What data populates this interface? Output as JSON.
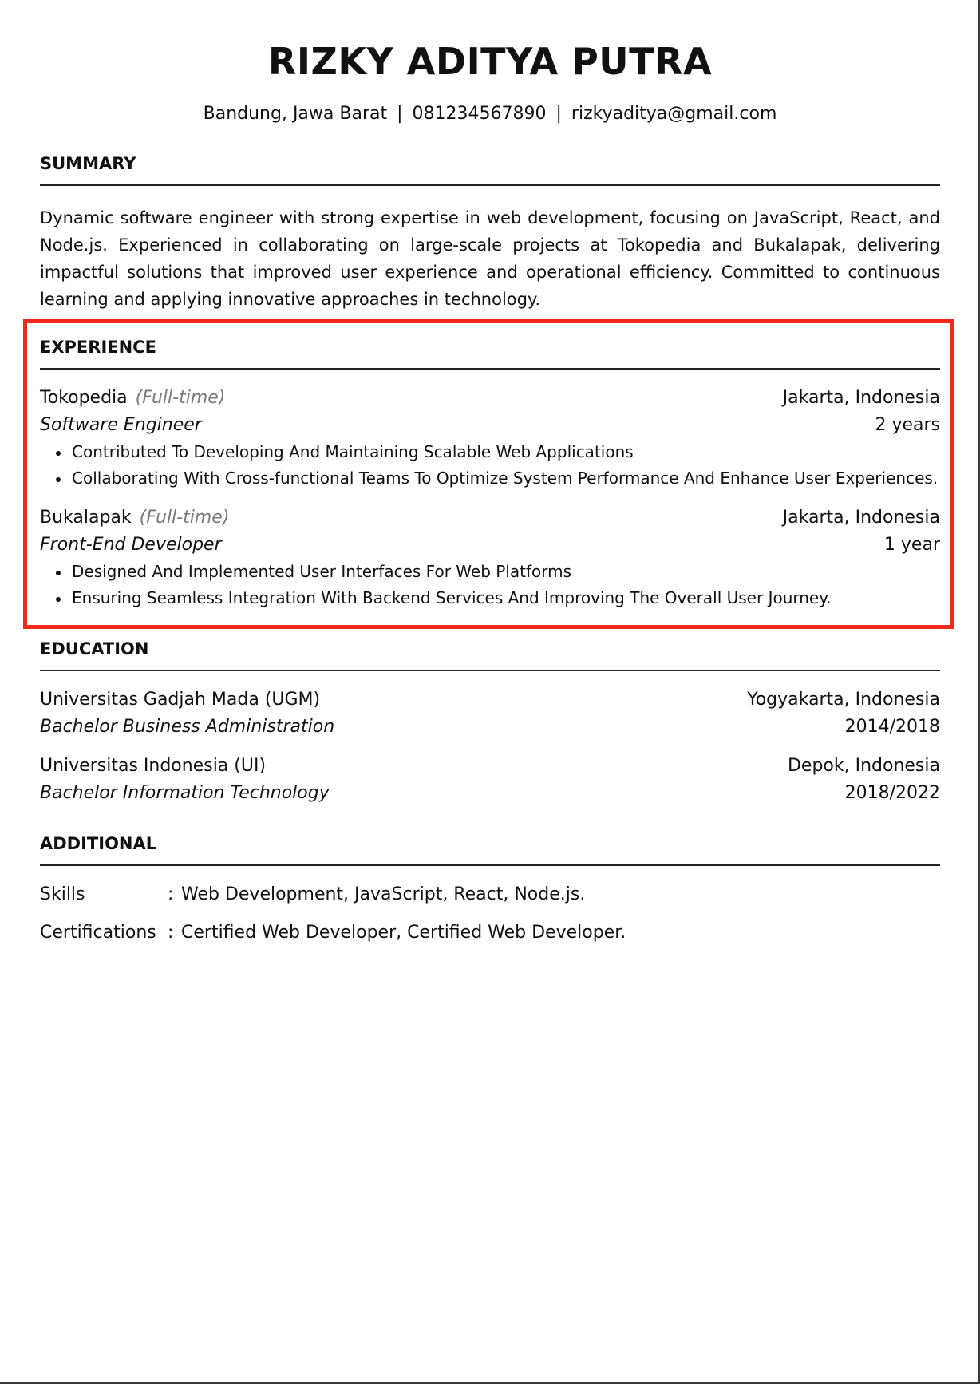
{
  "header": {
    "name": "RIZKY ADITYA PUTRA",
    "location": "Bandung, Jawa Barat",
    "phone": "081234567890",
    "email": "rizkyaditya@gmail.com",
    "separator": "|"
  },
  "summary": {
    "title": "SUMMARY",
    "text": "Dynamic software engineer with strong expertise in web development, focusing on JavaScript, React, and Node.js. Experienced in collaborating on large-scale projects at Tokopedia and Bukalapak, delivering impactful solutions that improved user experience and operational efficiency. Committed to continuous learning and applying innovative approaches in technology."
  },
  "experience": {
    "title": "EXPERIENCE",
    "jobs": [
      {
        "company": "Tokopedia",
        "type": "(Full-time)",
        "location": "Jakarta, Indonesia",
        "role": "Software Engineer",
        "duration": "2 years",
        "bullets": [
          "Contributed To Developing And Maintaining Scalable Web Applications",
          "Collaborating With Cross-functional Teams To Optimize System Performance And Enhance User Experiences."
        ]
      },
      {
        "company": "Bukalapak",
        "type": "(Full-time)",
        "location": "Jakarta, Indonesia",
        "role": "Front-End Developer",
        "duration": "1 year",
        "bullets": [
          "Designed And Implemented User Interfaces For Web Platforms",
          "Ensuring Seamless Integration With Backend Services And Improving The Overall User Journey."
        ]
      }
    ]
  },
  "education": {
    "title": "EDUCATION",
    "schools": [
      {
        "name": "Universitas Gadjah Mada (UGM)",
        "location": "Yogyakarta, Indonesia",
        "degree": "Bachelor Business Administration",
        "years": "2014/2018"
      },
      {
        "name": "Universitas Indonesia (UI)",
        "location": "Depok, Indonesia",
        "degree": "Bachelor Information Technology",
        "years": "2018/2022"
      }
    ]
  },
  "additional": {
    "title": "ADDITIONAL",
    "items": [
      {
        "label": "Skills",
        "colon": ":",
        "value": "Web Development, JavaScript, React, Node.js."
      },
      {
        "label": "Certifications",
        "colon": ":",
        "value": "Certified Web Developer, Certified Web Developer."
      }
    ]
  },
  "colors": {
    "highlight": "#f02b1d",
    "muted": "#7a7a7a",
    "text": "#111111"
  }
}
